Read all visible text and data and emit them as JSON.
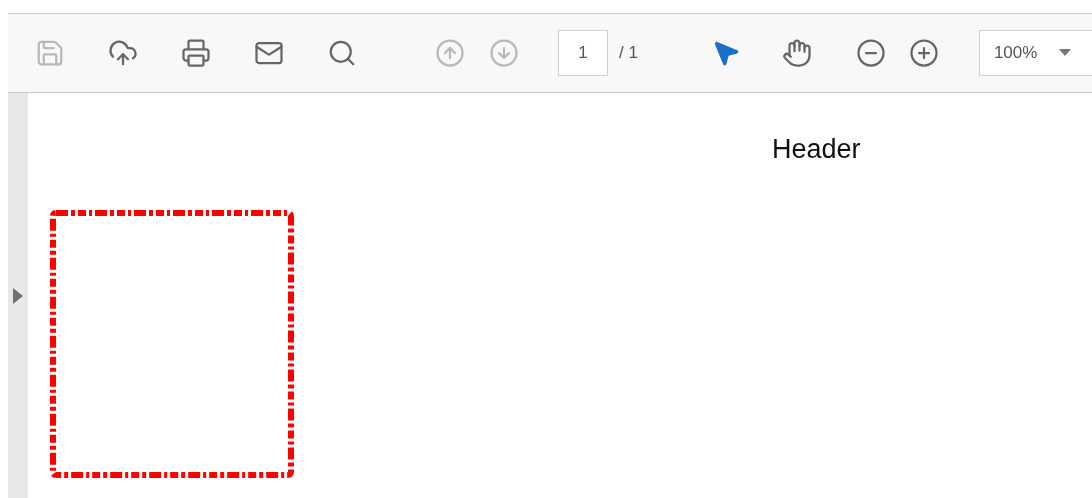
{
  "toolbar": {
    "file_tools": [
      {
        "kind": "save",
        "disabled": true
      },
      {
        "kind": "upload",
        "disabled": false
      },
      {
        "kind": "print",
        "disabled": false
      },
      {
        "kind": "mail",
        "disabled": false
      },
      {
        "kind": "search",
        "disabled": false
      }
    ],
    "nav_tools": [
      {
        "kind": "up",
        "disabled": true
      },
      {
        "kind": "down",
        "disabled": true
      }
    ],
    "page_field": {
      "value": "1"
    },
    "page_total": "/ 1",
    "pointer_tools": [
      {
        "kind": "select",
        "selected": true
      },
      {
        "kind": "hand",
        "selected": false
      }
    ],
    "zoom_tools": [
      {
        "kind": "zoom_out",
        "disabled": false
      },
      {
        "kind": "zoom_in",
        "disabled": false
      }
    ],
    "zoom_field": {
      "value": "100%"
    }
  },
  "document": {
    "header": "Header"
  }
}
